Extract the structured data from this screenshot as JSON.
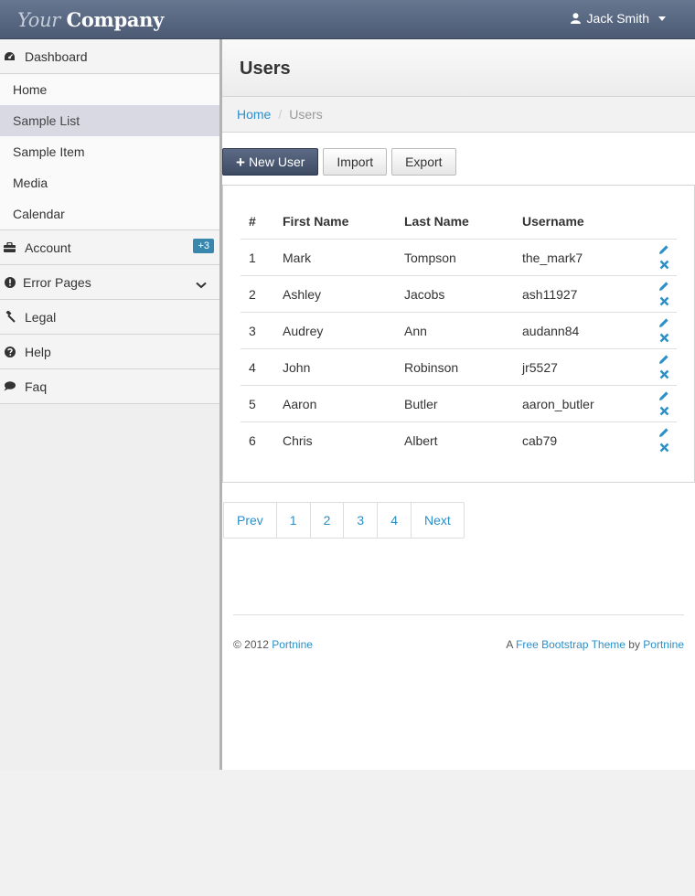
{
  "brand": {
    "light": "Your",
    "strong": "Company"
  },
  "user": {
    "name": "Jack Smith",
    "icon": "user-icon"
  },
  "sidebar": {
    "dashboard": {
      "label": "Dashboard",
      "icon": "dashboard-icon"
    },
    "items": [
      "Home",
      "Sample List",
      "Sample Item",
      "Media",
      "Calendar"
    ],
    "active_item": "Sample List",
    "account": {
      "label": "Account",
      "icon": "briefcase-icon",
      "badge": "+3"
    },
    "error_pages": {
      "label": "Error Pages",
      "icon": "exclamation-icon"
    },
    "legal": {
      "label": "Legal",
      "icon": "gavel-icon"
    },
    "help": {
      "label": "Help",
      "icon": "question-icon"
    },
    "faq": {
      "label": "Faq",
      "icon": "comment-icon"
    }
  },
  "page": {
    "title": "Users"
  },
  "breadcrumb": {
    "home": "Home",
    "current": "Users",
    "separator": "/"
  },
  "toolbar": {
    "new_user": "New User",
    "import": "Import",
    "export": "Export"
  },
  "table": {
    "headers": [
      "#",
      "First Name",
      "Last Name",
      "Username"
    ],
    "rows": [
      [
        "1",
        "Mark",
        "Tompson",
        "the_mark7"
      ],
      [
        "2",
        "Ashley",
        "Jacobs",
        "ash11927"
      ],
      [
        "3",
        "Audrey",
        "Ann",
        "audann84"
      ],
      [
        "4",
        "John",
        "Robinson",
        "jr5527"
      ],
      [
        "5",
        "Aaron",
        "Butler",
        "aaron_butler"
      ],
      [
        "6",
        "Chris",
        "Albert",
        "cab79"
      ]
    ]
  },
  "pagination": [
    "Prev",
    "1",
    "2",
    "3",
    "4",
    "Next"
  ],
  "footer": {
    "copyright": "© 2012",
    "left_link": "Portnine",
    "right_prefix": "A",
    "right_link": "Free Bootstrap Theme",
    "right_by": "by",
    "right_link2": "Portnine"
  },
  "colors": {
    "navbar": "#4c5a74",
    "link": "#2a8fc9",
    "badge": "#3a87ad",
    "primary_button": "#3e4b63"
  }
}
